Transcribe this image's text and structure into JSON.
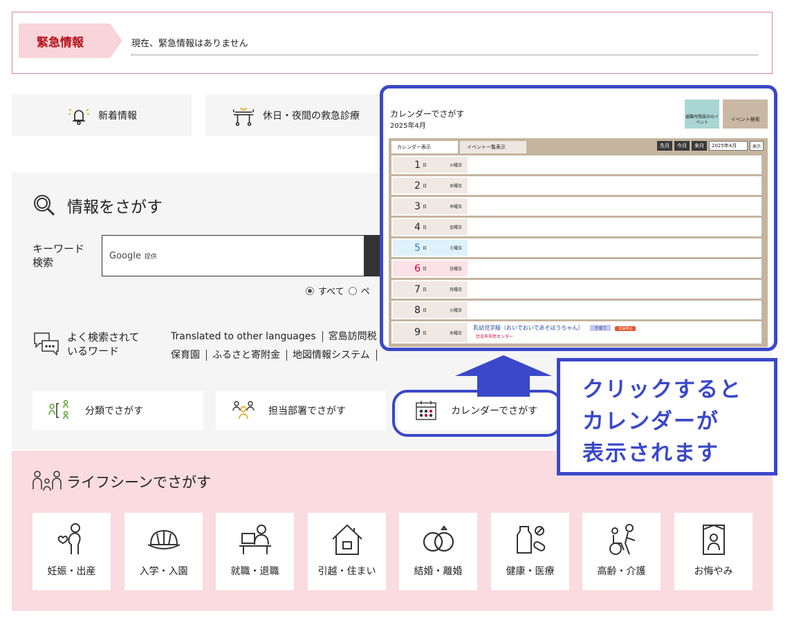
{
  "emergency": {
    "label": "緊急情報",
    "message": "現在、緊急情報はありません"
  },
  "quick": {
    "news": "新着情報",
    "er": "休日・夜間の救急診療"
  },
  "search": {
    "title": "情報をさがす",
    "keyword_label_1": "キーワード",
    "keyword_label_2": "検索",
    "google": "Google",
    "google_sub": "提供",
    "radio_all": "すべて",
    "radio_page": "ペ"
  },
  "popular": {
    "label_1": "よく検索されて",
    "label_2": "いるワード",
    "row1": [
      "Translated to other languages",
      "宮島訪問税"
    ],
    "row2": [
      "保育園",
      "ふるさと寄附金",
      "地図情報システム"
    ]
  },
  "categories": {
    "classification": "分類でさがす",
    "department": "担当部署でさがす",
    "calendar": "カレンダーでさがす"
  },
  "life": {
    "title": "ライフシーンでさがす",
    "tiles": [
      "妊娠・出産",
      "入学・入園",
      "就職・退職",
      "引越・住まい",
      "結婚・離婚",
      "健康・医療",
      "高齢・介護",
      "お悔やみ"
    ]
  },
  "calendar": {
    "title": "カレンダーでさがす",
    "date": "2025年4月",
    "btn_green": "避難所開設中のイベント",
    "btn_search": "イベント検索",
    "tab_calendar": "カレンダー表示",
    "tab_list": "イベント一覧表示",
    "nav_prev": "先月",
    "nav_today": "今月",
    "nav_next": "来月",
    "nav_select": "2025年4月",
    "nav_go": "表示",
    "day_unit": "日",
    "days": [
      {
        "n": "1",
        "w": "火曜日"
      },
      {
        "n": "2",
        "w": "水曜日"
      },
      {
        "n": "3",
        "w": "木曜日"
      },
      {
        "n": "4",
        "w": "金曜日"
      },
      {
        "n": "5",
        "w": "土曜日"
      },
      {
        "n": "6",
        "w": "日曜日"
      },
      {
        "n": "7",
        "w": "月曜日"
      },
      {
        "n": "8",
        "w": "火曜日"
      },
      {
        "n": "9",
        "w": "水曜日"
      }
    ],
    "event_title": "乳幼児学級（おいでおいであそぼうちゃん）",
    "event_badge": "子育て",
    "event_tag": "定員申込",
    "event_place": "廿日市市民センター"
  },
  "callout": {
    "line1": "クリックすると",
    "line2": "カレンダーが",
    "line3": "表示されます"
  },
  "colors": {
    "accent_blue": "#3a48c9",
    "emergency_red": "#b5121b",
    "pink_bg": "#fadbdf"
  }
}
